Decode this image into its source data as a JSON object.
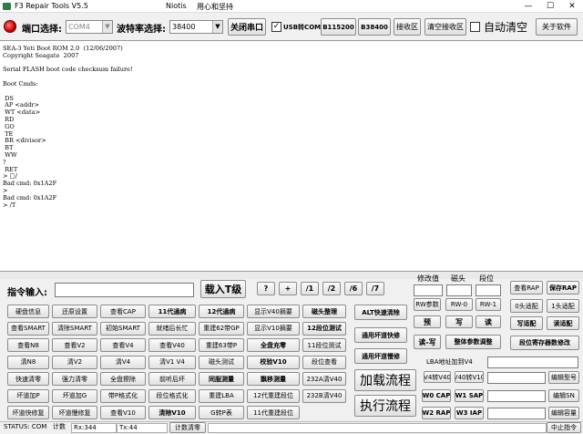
{
  "titlebar": {
    "app_title": "F3 Repair Tools V5.5",
    "niotis": "Niotis",
    "subtitle": "用心和坚持",
    "min": "—",
    "max": "☐",
    "close": "✕"
  },
  "toolbar": {
    "port_label": "端口选择:",
    "port_value": "COM4",
    "baud_label": "波特率选择:",
    "baud_value": "38400",
    "close_port": "关闭串口",
    "usb_com_label": "USB转COM",
    "usb_com_checked": true,
    "b115200": "B115200",
    "b38400": "B38400",
    "recv_area": "接收区",
    "clear_recv_area": "清空接收区",
    "auto_clear_label": "自动清空",
    "about": "关于软件"
  },
  "terminal": {
    "lines": [
      "SEA-3 Yeti Boot ROM 2.0  (12/06/2007)",
      "Copyright Seagate  2007",
      "",
      "Serial FLASH boot code checksum failure!",
      "",
      "Boot Cmds:",
      "",
      " DS",
      " AP <addr>",
      " WT <data>",
      " RD",
      " GO",
      " TE",
      " BR <divisor>",
      " BT",
      " WW",
      "?",
      " RET",
      "> □/",
      "Bad cmd: 0x1A2F",
      ">",
      "Bad cmd: 0x1A2F",
      "> /T"
    ]
  },
  "panel": {
    "cmd_input_label": "指令输入:",
    "load_t_level": "载入T级",
    "level_buttons": [
      "?",
      "+",
      "/1",
      "/2",
      "/6",
      "/7"
    ],
    "col_labels": {
      "modify_value": "修改值",
      "head": "磁头",
      "segment": "段位"
    },
    "grid_rows": [
      [
        "硬盘信息",
        "还原设置",
        "查看CAP",
        "11代通病",
        "12代通病",
        "显示V40摘要",
        "磁头整理"
      ],
      [
        "查看SMART",
        "清除SMART",
        "初始SMART",
        "就绪后长忙",
        "重建62带GP",
        "显示V10摘要",
        "12段位测试"
      ],
      [
        "查看N8",
        "查看V2",
        "查看V4",
        "查看V40",
        "重建63带P",
        "全盘充零",
        "11段位测试"
      ],
      [
        "清N8",
        "清V2",
        "清V4",
        "清V1 V4",
        "磁头测试",
        "校验V10",
        "段位查看"
      ],
      [
        "快速清零",
        "强力清零",
        "全盘擦除",
        "前听后坏",
        "同服测量",
        "飘移测量",
        "232A清V40"
      ],
      [
        "坏道加P",
        "坏道加G",
        "带P格式化",
        "段位格式化",
        "重建LBA",
        "12代重建段位",
        "232B清V40"
      ],
      [
        "坏道快修复",
        "坏道慢修复",
        "查看V10",
        "清除V10",
        "G转P表",
        "11代重建段位"
      ]
    ],
    "alt_fast_clear": "ALT快速清除",
    "universal_fast_fix": "通用坏道快修",
    "universal_slow_fix": "通用坏道慢修",
    "load_flow": "加载流程",
    "exec_flow": "执行流程",
    "rw_params": "RW参数",
    "rw0": "RW-0",
    "rw1": "RW-1",
    "pre": "预",
    "write": "写",
    "read": "读",
    "read_write": "读-写",
    "overall_adjust": "整体参数调整",
    "lba_add_v4": "LBA地址加到V4",
    "v4_to_v40": "V4转V40",
    "v40_to_v10": "V40转V10",
    "w0_cap": "W0 CAP",
    "w1_sap": "W1 SAP",
    "w2_rap": "W2 RAP",
    "w3_iap": "W3 IAP",
    "view_rap": "查看RAP",
    "save_rap": "保存RAP",
    "zero_head_adapt": "0头适配",
    "one_head_adapt": "1头适配",
    "write_adapt": "写适配",
    "read_adapt": "读适配",
    "segment_register_modify": "段位寄存器数修改",
    "edit_model": "编辑型号",
    "edit_sn": "编辑SN",
    "edit_capacity": "编辑容量",
    "stop_cmd": "中止指令"
  },
  "status": {
    "status_text": "STATUS: COM",
    "count_label": "计数",
    "rx": "Rx:344",
    "tx": "Tx:44",
    "count_clear": "计数清零"
  }
}
